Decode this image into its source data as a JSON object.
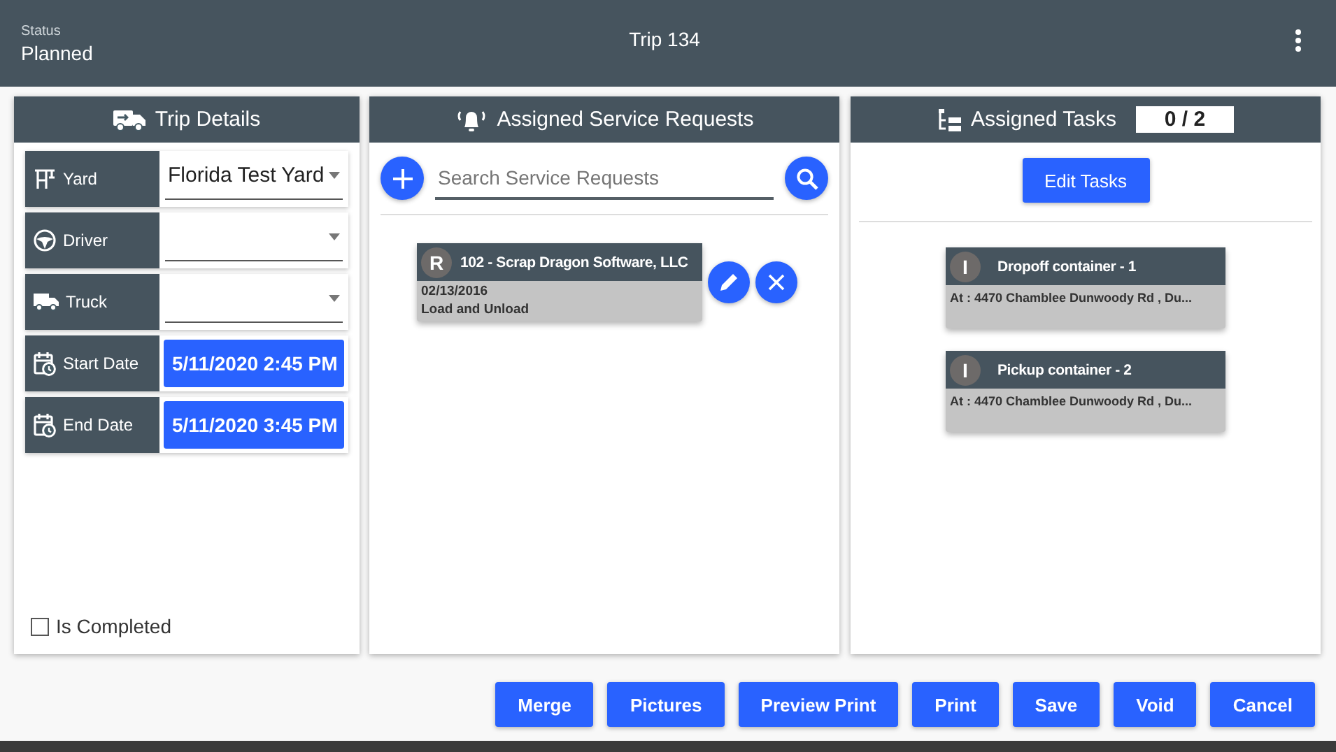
{
  "header": {
    "status_label": "Status",
    "status": "Planned",
    "title": "Trip 134"
  },
  "trip_details": {
    "title": "Trip Details",
    "fields": [
      {
        "kind": "select",
        "label": "Yard",
        "value": "Florida Test Yard"
      },
      {
        "kind": "select",
        "label": "Driver"
      },
      {
        "kind": "select",
        "label": "Truck"
      },
      {
        "kind": "date",
        "label": "Start Date",
        "value": "5/11/2020 2:45 PM"
      },
      {
        "kind": "date",
        "label": "End Date",
        "value": "5/11/2020 3:45 PM"
      }
    ],
    "completed": {
      "label": "Is Completed",
      "checked": false
    }
  },
  "service_requests": {
    "title": "Assigned Service Requests",
    "search": {
      "placeholder": "Search Service Requests"
    },
    "items": [
      {
        "badge": "R",
        "title": "102 - Scrap Dragon Software, LLC",
        "date": "02/13/2016",
        "type": "Load and Unload"
      }
    ]
  },
  "tasks": {
    "title": "Assigned Tasks",
    "count": "0 / 2",
    "edit_button": "Edit Tasks",
    "items": [
      {
        "badge": "I",
        "title": "Dropoff container - 1",
        "address": "At : 4470 Chamblee Dunwoody Rd , Du..."
      },
      {
        "badge": "I",
        "title": "Pickup container - 2",
        "address": "At : 4470 Chamblee Dunwoody Rd , Du..."
      }
    ]
  },
  "buttons": [
    "Merge",
    "Pictures",
    "Preview Print",
    "Print",
    "Save",
    "Void",
    "Cancel"
  ]
}
